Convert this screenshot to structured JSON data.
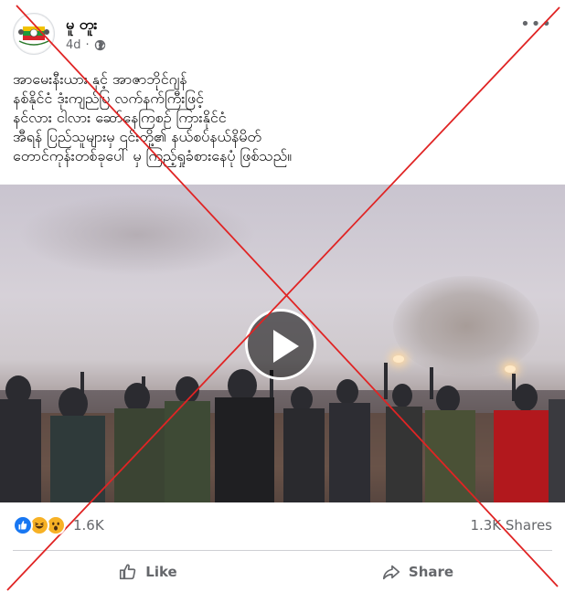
{
  "post": {
    "page_name": "မူ တူး",
    "time": "4d",
    "more_label": "•••",
    "text": "အာမေးနီးယား နှင့် အာဇာဘိုင်ဂျန်\nနစ်နိုင်ငံ ဒုံးကျည်ပြ လက်နက်ကြီးဖြင့်\nနင်လား ငါလား ဆော်နေကြစဉ် ကြားနိုင်ငံ\nအီရန် ပြည်သူများမှ ၎င်းတို့၏ နယ်စပ်နယ်နိမိတ်\nတောင်ကုန်းတစ်ခုပေါ် မှ ကြည့်ရှုခံစားနေပုံ ဖြစ်သည်။"
  },
  "icons": {
    "globe": "globe-icon",
    "play": "play-icon",
    "like": "like-icon",
    "share": "share-icon"
  },
  "stats": {
    "reaction_count": "1.6K",
    "shares_label": "1.3K Shares"
  },
  "actions": {
    "like_label": "Like",
    "share_label": "Share"
  },
  "colors": {
    "like_blue": "#1877f2",
    "cross_red": "#e02424",
    "muted_text": "#65676b"
  }
}
